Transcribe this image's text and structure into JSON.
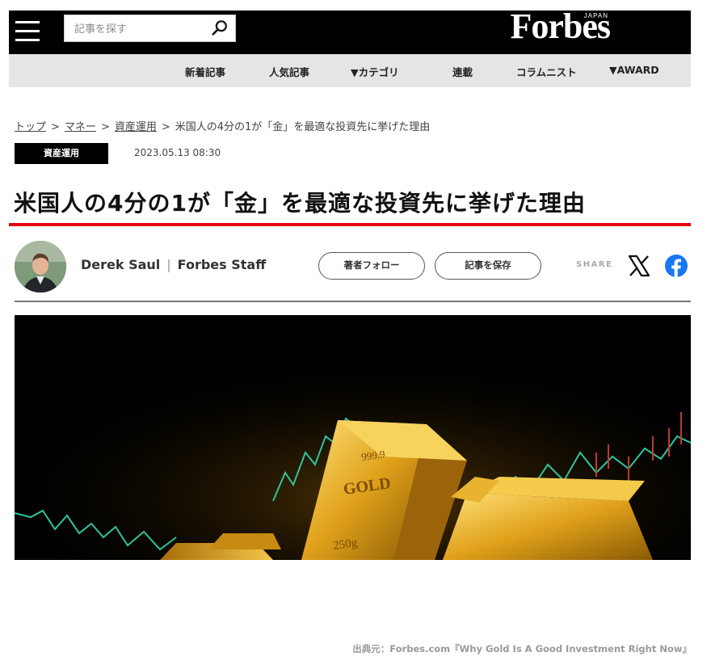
{
  "header": {
    "search_placeholder": "記事を探す",
    "logo": "Forbes",
    "logo_sub": "JAPAN"
  },
  "nav": {
    "items": [
      "新着記事",
      "人気記事",
      "▼カテゴリ",
      "連載",
      "コラムニスト",
      "▼AWARD"
    ]
  },
  "breadcrumb": {
    "items": [
      "トップ",
      "マネー",
      "資産運用"
    ],
    "current": "米国人の4分の1が「金」を最適な投資先に挙げた理由",
    "separator": ">"
  },
  "article": {
    "category_tag": "資産運用",
    "date": "2023.05.13 08:30",
    "title": "米国人の4分の1が「金」を最適な投資先に挙げた理由",
    "author_name": "Derek Saul",
    "author_role": "Forbes Staff",
    "follow_label": "著者フォロー",
    "save_label": "記事を保存",
    "share_label": "SHARE"
  },
  "image": {
    "bar_text_top": "999.9",
    "bar_text_mid": "GOLD",
    "bar_text_bottom": "250g"
  },
  "credit": "出典元：Forbes.com『Why Gold Is A Good Investment Right Now』",
  "colors": {
    "header_bg": "#000000",
    "nav_bg": "#e5e5e5",
    "accent_red": "#e60012",
    "facebook_blue": "#1877f2",
    "gold": "#d9a520"
  }
}
